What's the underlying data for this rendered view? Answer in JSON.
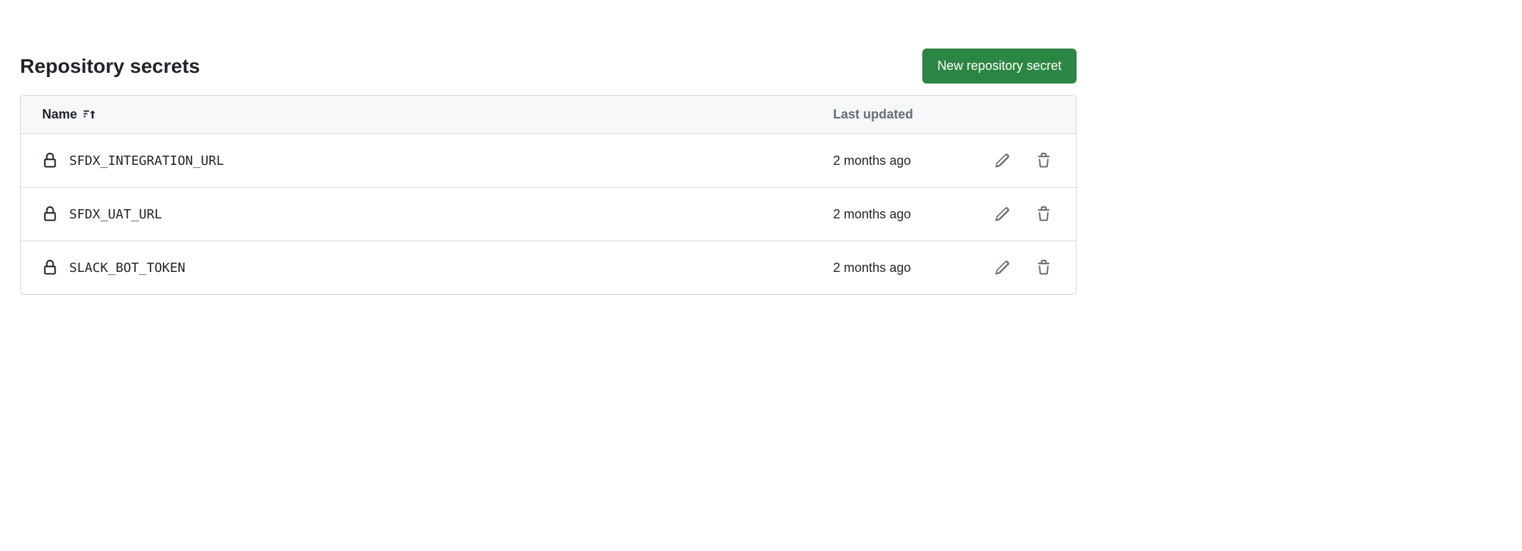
{
  "section": {
    "title": "Repository secrets",
    "new_button_label": "New repository secret"
  },
  "table": {
    "header": {
      "name": "Name",
      "last_updated": "Last updated"
    },
    "rows": [
      {
        "name": "SFDX_INTEGRATION_URL",
        "last_updated": "2 months ago"
      },
      {
        "name": "SFDX_UAT_URL",
        "last_updated": "2 months ago"
      },
      {
        "name": "SLACK_BOT_TOKEN",
        "last_updated": "2 months ago"
      }
    ]
  }
}
